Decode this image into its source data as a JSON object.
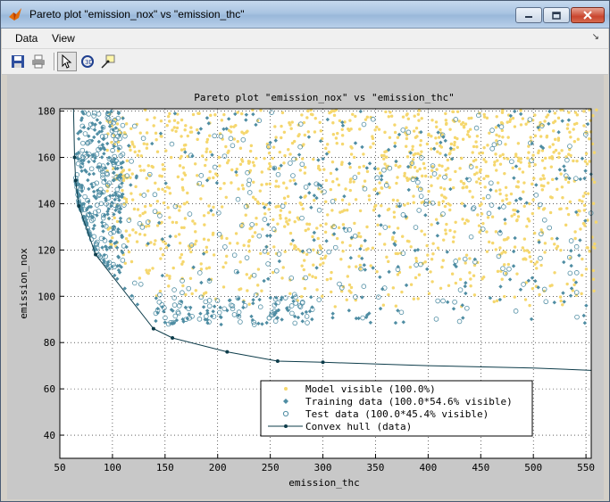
{
  "window": {
    "title": "Pareto plot \"emission_nox\" vs \"emission_thc\"",
    "minimize_icon": "minimize-icon",
    "maximize_icon": "maximize-icon",
    "close_icon": "close-icon"
  },
  "menubar": {
    "items": [
      {
        "label": "Data"
      },
      {
        "label": "View"
      }
    ],
    "overflow_icon": "chevron-icon"
  },
  "toolbar": {
    "buttons": [
      {
        "name": "save",
        "icon": "save-icon"
      },
      {
        "name": "print",
        "icon": "print-icon"
      },
      {
        "name": "select",
        "icon": "cursor-icon"
      },
      {
        "name": "rotate",
        "icon": "rotate-icon"
      },
      {
        "name": "data-cursor",
        "icon": "data-cursor-icon"
      }
    ]
  },
  "chart_data": {
    "type": "scatter",
    "title": "Pareto plot \"emission_nox\" vs \"emission_thc\"",
    "xlabel": "emission_thc",
    "ylabel": "emission_nox",
    "xlim": [
      50,
      555
    ],
    "ylim": [
      30,
      181
    ],
    "x_ticks": [
      50,
      100,
      150,
      200,
      250,
      300,
      350,
      400,
      450,
      500,
      550
    ],
    "y_ticks": [
      40,
      60,
      80,
      100,
      120,
      140,
      160,
      180
    ],
    "grid": true,
    "legend_position": "bottom-center",
    "series": [
      {
        "name": "Model visible (100.0%)",
        "marker": "dot",
        "color": "#f5d76e"
      },
      {
        "name": "Training data (100.0*54.6% visible)",
        "marker": "diamond",
        "color": "#4f8da3"
      },
      {
        "name": "Test data (100.0*45.4% visible)",
        "marker": "circle",
        "color": "#4f8da3"
      },
      {
        "name": "Convex hull (data)",
        "marker": "line",
        "color": "#0d3c4a",
        "points": [
          [
            63,
            185
          ],
          [
            64,
            160
          ],
          [
            65,
            150
          ],
          [
            68,
            139
          ],
          [
            84,
            118
          ],
          [
            139,
            86
          ],
          [
            157,
            82
          ],
          [
            209,
            76
          ],
          [
            257,
            72
          ],
          [
            300,
            71.5
          ],
          [
            400,
            70
          ],
          [
            500,
            69
          ],
          [
            555,
            68
          ]
        ]
      }
    ],
    "cloud_regions": {
      "model": [
        [
          95,
          570,
          95,
          180
        ]
      ],
      "training": [
        [
          65,
          560,
          70,
          180
        ]
      ],
      "test": [
        [
          65,
          560,
          70,
          180
        ]
      ]
    }
  }
}
